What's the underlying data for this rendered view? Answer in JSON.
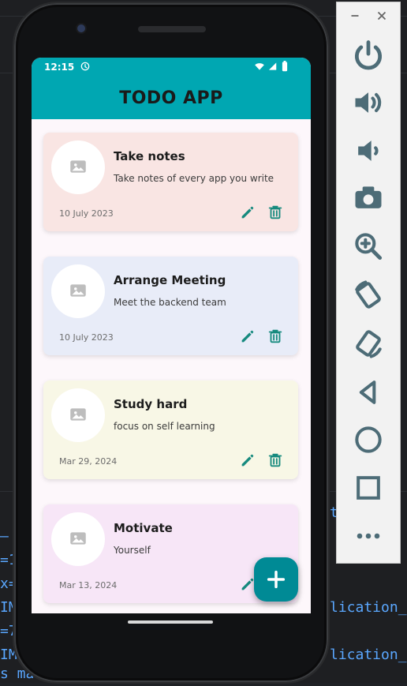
{
  "status_bar": {
    "time": "12:15"
  },
  "app_bar": {
    "title": "TODO APP"
  },
  "todos": [
    {
      "title": "Take notes",
      "subtitle": "Take notes of every app you write",
      "date": "10 July 2023",
      "background": "#f9e5e3"
    },
    {
      "title": "Arrange Meeting",
      "subtitle": "Meet the backend team",
      "date": "10 July 2023",
      "background": "#e8ecf8"
    },
    {
      "title": "Study hard",
      "subtitle": "focus on self learning",
      "date": "Mar 29, 2024",
      "background": "#f8f7e6"
    },
    {
      "title": "Motivate",
      "subtitle": "Yourself",
      "date": "Mar 13, 2024",
      "background": "#f7e6f7"
    }
  ],
  "colors": {
    "accent": "#00a7b2",
    "fab": "#008a95",
    "icon_teal": "#168a7e"
  },
  "ide_overlay": {
    "lines": [
      "–",
      "=1",
      "x=",
      "IM",
      "=7",
      "IM",
      "s ma",
      "lication_",
      "lication_",
      "te"
    ]
  }
}
